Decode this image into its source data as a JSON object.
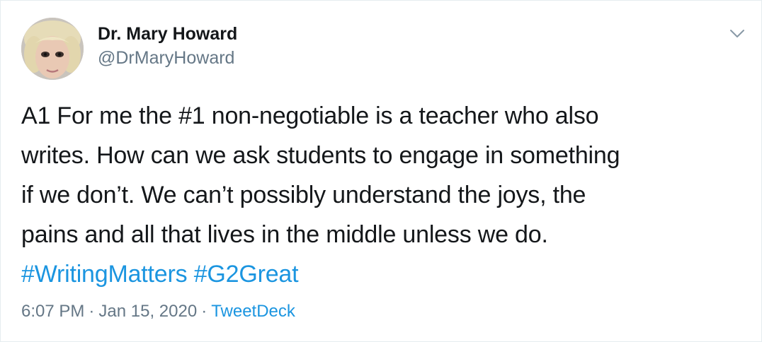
{
  "author": {
    "display_name": "Dr. Mary Howard",
    "handle": "@DrMaryHoward"
  },
  "tweet": {
    "lines": [
      "A1 For me the #1 non-negotiable is a teacher who also",
      "writes. How can we ask students to engage in something",
      "if we don’t. We can’t possibly understand the joys, the",
      "pains and all that lives in the middle unless we do."
    ],
    "hashtags": [
      "#WritingMatters",
      "#G2Great"
    ]
  },
  "meta": {
    "time": "6:07 PM",
    "separator": "·",
    "date": "Jan 15, 2020",
    "source": "TweetDeck"
  },
  "icons": {
    "menu": "chevron-down-icon"
  },
  "colors": {
    "link": "#1b95e0",
    "text": "#14171a",
    "secondary": "#657786"
  }
}
